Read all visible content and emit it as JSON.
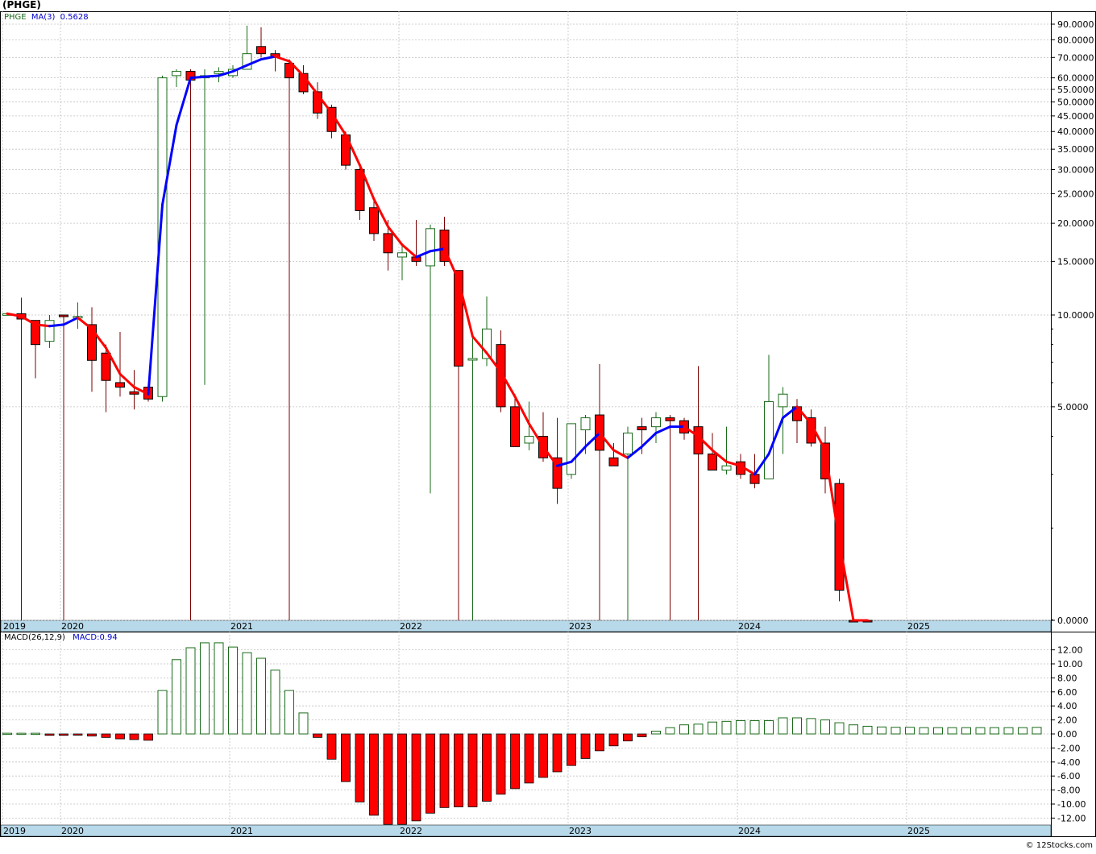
{
  "title": "(PHGE)",
  "footer": "© 12Stocks.com",
  "colors": {
    "up_edge": "#1a6b1a",
    "down_fill": "#ff0000",
    "down_edge": "#7a0000",
    "ma_up": "#0000ff",
    "ma_down": "#ff0000",
    "grid": "#c0c0c0",
    "axis_band": "#b7d9ea"
  },
  "legends": {
    "price_symbol": "PHGE",
    "price_ma": "MA(3)",
    "price_ma_value": "0.5628",
    "macd_name": "MACD(26,12,9)",
    "macd_value_label": "MACD:0.94"
  },
  "chart_data": [
    {
      "type": "candlestick",
      "scale": "log",
      "interval": "monthly",
      "yticks": [
        "90.0000",
        "80.0000",
        "70.0000",
        "60.0000",
        "55.0000",
        "50.0000",
        "45.0000",
        "40.0000",
        "35.0000",
        "30.0000",
        "25.0000",
        "20.0000",
        "15.0000",
        "10.0000",
        "5.0000",
        "0.0000"
      ],
      "ytick_values": [
        90,
        80,
        70,
        60,
        55,
        50,
        45,
        40,
        35,
        30,
        25,
        20,
        15,
        10,
        5,
        0
      ],
      "xticks": [
        "2019",
        "2020",
        "2021",
        "2022",
        "2023",
        "2024",
        "2025"
      ],
      "xtick_index": [
        0,
        4,
        16,
        28,
        40,
        52,
        64
      ],
      "ohlc": [
        [
          10.1,
          10.2,
          10.0,
          10.1
        ],
        [
          10.1,
          11.4,
          0,
          9.7
        ],
        [
          9.6,
          9.6,
          6.2,
          8.0
        ],
        [
          8.2,
          10.0,
          7.8,
          9.6
        ],
        [
          10.0,
          10.0,
          0,
          9.9
        ],
        [
          9.9,
          11.0,
          9.0,
          9.9
        ],
        [
          9.3,
          10.6,
          5.6,
          7.1
        ],
        [
          7.5,
          8.0,
          4.8,
          6.1
        ],
        [
          6.0,
          8.8,
          5.4,
          5.8
        ],
        [
          5.6,
          6.6,
          4.9,
          5.5
        ],
        [
          5.8,
          5.8,
          5.2,
          5.3
        ],
        [
          5.4,
          61,
          5.2,
          60
        ],
        [
          61,
          64,
          56,
          63
        ],
        [
          63,
          64,
          0,
          59
        ],
        [
          60,
          64,
          5.9,
          61
        ],
        [
          62,
          65,
          58,
          63
        ],
        [
          61,
          66,
          60,
          64
        ],
        [
          64,
          89,
          65,
          72
        ],
        [
          76,
          88,
          70,
          72
        ],
        [
          72,
          74,
          63,
          70
        ],
        [
          67,
          69,
          0,
          60
        ],
        [
          62,
          66,
          53,
          54
        ],
        [
          54,
          58,
          44,
          46
        ],
        [
          48,
          49,
          38,
          40
        ],
        [
          39,
          40,
          30,
          31
        ],
        [
          30,
          31,
          20.5,
          22
        ],
        [
          22.5,
          24,
          17.5,
          18.5
        ],
        [
          18.5,
          20.5,
          14,
          16
        ],
        [
          15.5,
          17,
          13,
          16
        ],
        [
          15.5,
          20.5,
          14.5,
          15
        ],
        [
          14.5,
          19.8,
          2.6,
          19.2
        ],
        [
          19,
          21,
          14.5,
          15
        ],
        [
          14,
          14,
          0,
          6.8
        ],
        [
          7.2,
          8.7,
          0,
          7.2
        ],
        [
          7.2,
          11.5,
          6.8,
          9.0
        ],
        [
          8.0,
          8.9,
          4.8,
          5.0
        ],
        [
          5.0,
          5.5,
          3.7,
          3.7
        ],
        [
          3.8,
          5.2,
          3.6,
          4.0
        ],
        [
          4.0,
          4.8,
          3.3,
          3.4
        ],
        [
          3.4,
          4.6,
          2.4,
          2.7
        ],
        [
          3.0,
          4.4,
          2.9,
          4.4
        ],
        [
          4.2,
          4.7,
          3.5,
          4.6
        ],
        [
          4.7,
          6.9,
          0,
          3.6
        ],
        [
          3.4,
          3.8,
          3.2,
          3.2
        ],
        [
          3.5,
          4.3,
          0,
          4.1
        ],
        [
          4.3,
          4.6,
          3.5,
          4.2
        ],
        [
          4.3,
          4.8,
          3.8,
          4.6
        ],
        [
          4.6,
          4.7,
          0,
          4.5
        ],
        [
          4.5,
          4.6,
          3.9,
          4.1
        ],
        [
          4.3,
          6.8,
          0,
          3.5
        ],
        [
          3.5,
          4.1,
          3.1,
          3.1
        ],
        [
          3.1,
          4.3,
          3.0,
          3.2
        ],
        [
          3.3,
          3.5,
          2.9,
          3.0
        ],
        [
          3.0,
          3.5,
          2.7,
          2.8
        ],
        [
          2.9,
          7.4,
          2.9,
          5.2
        ],
        [
          5.0,
          5.8,
          3.5,
          5.5
        ],
        [
          5.0,
          5.3,
          3.8,
          4.5
        ],
        [
          4.6,
          4.9,
          3.7,
          3.8
        ],
        [
          3.8,
          4.3,
          2.6,
          2.9
        ],
        [
          2.8,
          2.9,
          1.15,
          1.25
        ],
        [
          0.8,
          0.8,
          0.1,
          0.1
        ],
        [
          0.35,
          0.4,
          0.1,
          0.12
        ],
        [
          null,
          null,
          null,
          null
        ],
        [
          null,
          null,
          null,
          null
        ],
        [
          null,
          0.6,
          0.01,
          null
        ]
      ],
      "ma3": [
        10.1,
        9.9,
        9.3,
        9.2,
        9.3,
        9.8,
        9.0,
        7.8,
        6.4,
        5.8,
        5.5,
        23,
        42,
        60,
        60.5,
        61,
        63,
        66,
        69,
        70.5,
        68,
        61,
        53,
        46,
        39,
        31,
        24,
        19.5,
        17,
        15.5,
        16.2,
        16.5,
        13,
        8.5,
        7.5,
        6.5,
        5.4,
        4.4,
        3.7,
        3.2,
        3.3,
        3.7,
        4.1,
        3.6,
        3.4,
        3.7,
        4.1,
        4.3,
        4.3,
        4.0,
        3.6,
        3.3,
        3.2,
        3.0,
        3.5,
        4.6,
        5.0,
        4.4,
        3.6,
        1.8,
        0.2,
        0.05
      ]
    },
    {
      "type": "bar",
      "name": "MACD(26,12,9)",
      "yticks": [
        "12.00",
        "10.00",
        "8.00",
        "6.00",
        "4.00",
        "2.00",
        "0.00",
        "-2.00",
        "-4.00",
        "-6.00",
        "-8.00",
        "-10.00",
        "-12.00"
      ],
      "ytick_values": [
        12,
        10,
        8,
        6,
        4,
        2,
        0,
        -2,
        -4,
        -6,
        -8,
        -10,
        -12
      ],
      "ylim": [
        -13,
        13.5
      ],
      "xticks": [
        "2019",
        "2020",
        "2021",
        "2022",
        "2023",
        "2024",
        "2025"
      ],
      "values": [
        0.1,
        0.1,
        0.1,
        -0.2,
        -0.2,
        -0.1,
        -0.3,
        -0.5,
        -0.7,
        -0.8,
        -0.9,
        6.2,
        10.6,
        12.3,
        13.0,
        13.0,
        12.4,
        11.6,
        10.8,
        9.1,
        6.2,
        3.0,
        -0.5,
        -3.6,
        -6.8,
        -9.7,
        -11.6,
        -12.9,
        -12.9,
        -12.4,
        -11.3,
        -10.5,
        -10.4,
        -10.4,
        -9.6,
        -8.6,
        -7.8,
        -7.0,
        -6.2,
        -5.4,
        -4.5,
        -3.5,
        -2.4,
        -1.7,
        -1.0,
        -0.4,
        0.4,
        0.9,
        1.3,
        1.4,
        1.7,
        1.8,
        1.9,
        1.9,
        1.9,
        2.3,
        2.3,
        2.2,
        2.0,
        1.6,
        1.3,
        1.1,
        1.0,
        0.95,
        0.95,
        0.9,
        0.9,
        0.9,
        0.9,
        0.9,
        0.9,
        0.9,
        0.9,
        0.94
      ]
    }
  ]
}
